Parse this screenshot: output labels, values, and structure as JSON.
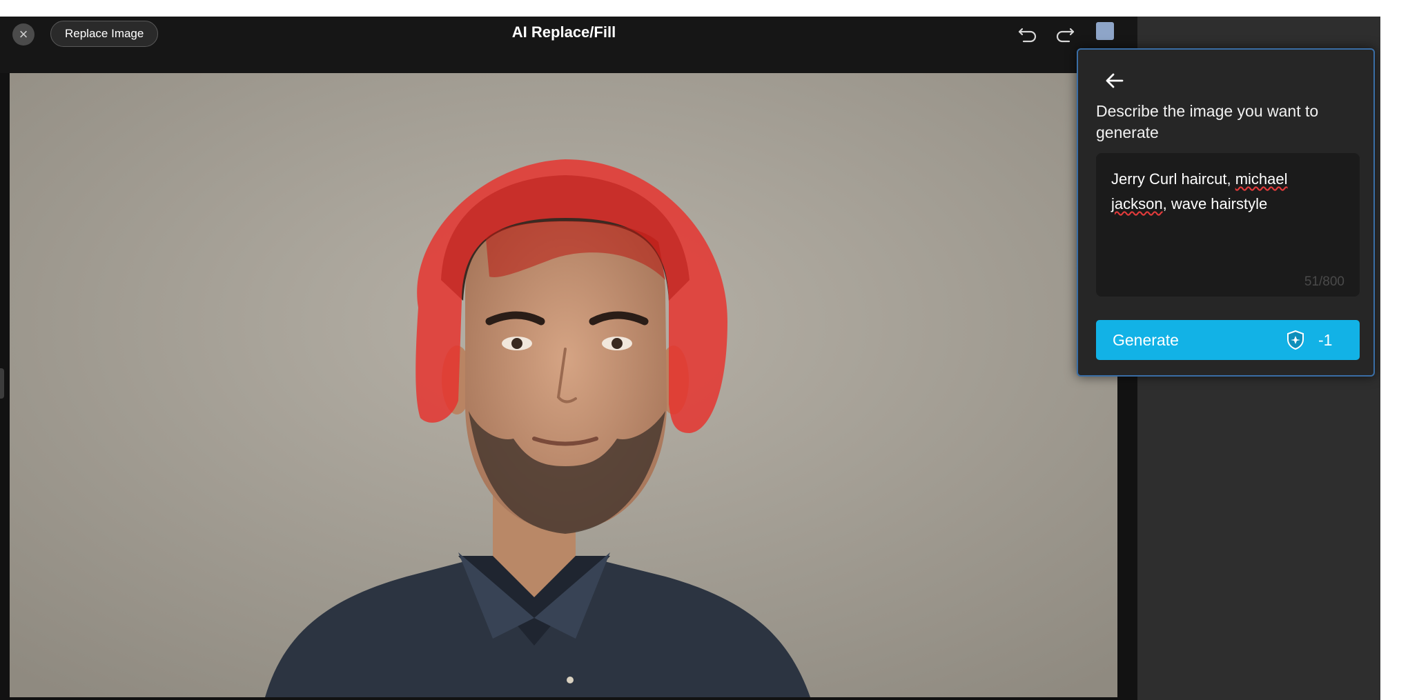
{
  "header": {
    "title": "AI Replace/Fill",
    "replace_image_label": "Replace Image",
    "close_icon": "close-icon",
    "undo_icon": "undo-icon",
    "redo_icon": "redo-icon",
    "compare_icon": "compare-icon"
  },
  "popover": {
    "back_icon": "arrow-left-icon",
    "heading": "Describe the image you want to generate",
    "prompt": {
      "part1": "Jerry Curl haircut, ",
      "word1": "michael",
      "space": " ",
      "word2": "jackson",
      "part2": ", wave hairstyle"
    },
    "char_count": "51/800",
    "generate_label": "Generate",
    "credit_icon": "credit-icon",
    "credit_cost": "-1"
  },
  "colors": {
    "accent": "#12b2e6",
    "mask": "#e8312c",
    "popover_border": "#3a6ea6"
  }
}
